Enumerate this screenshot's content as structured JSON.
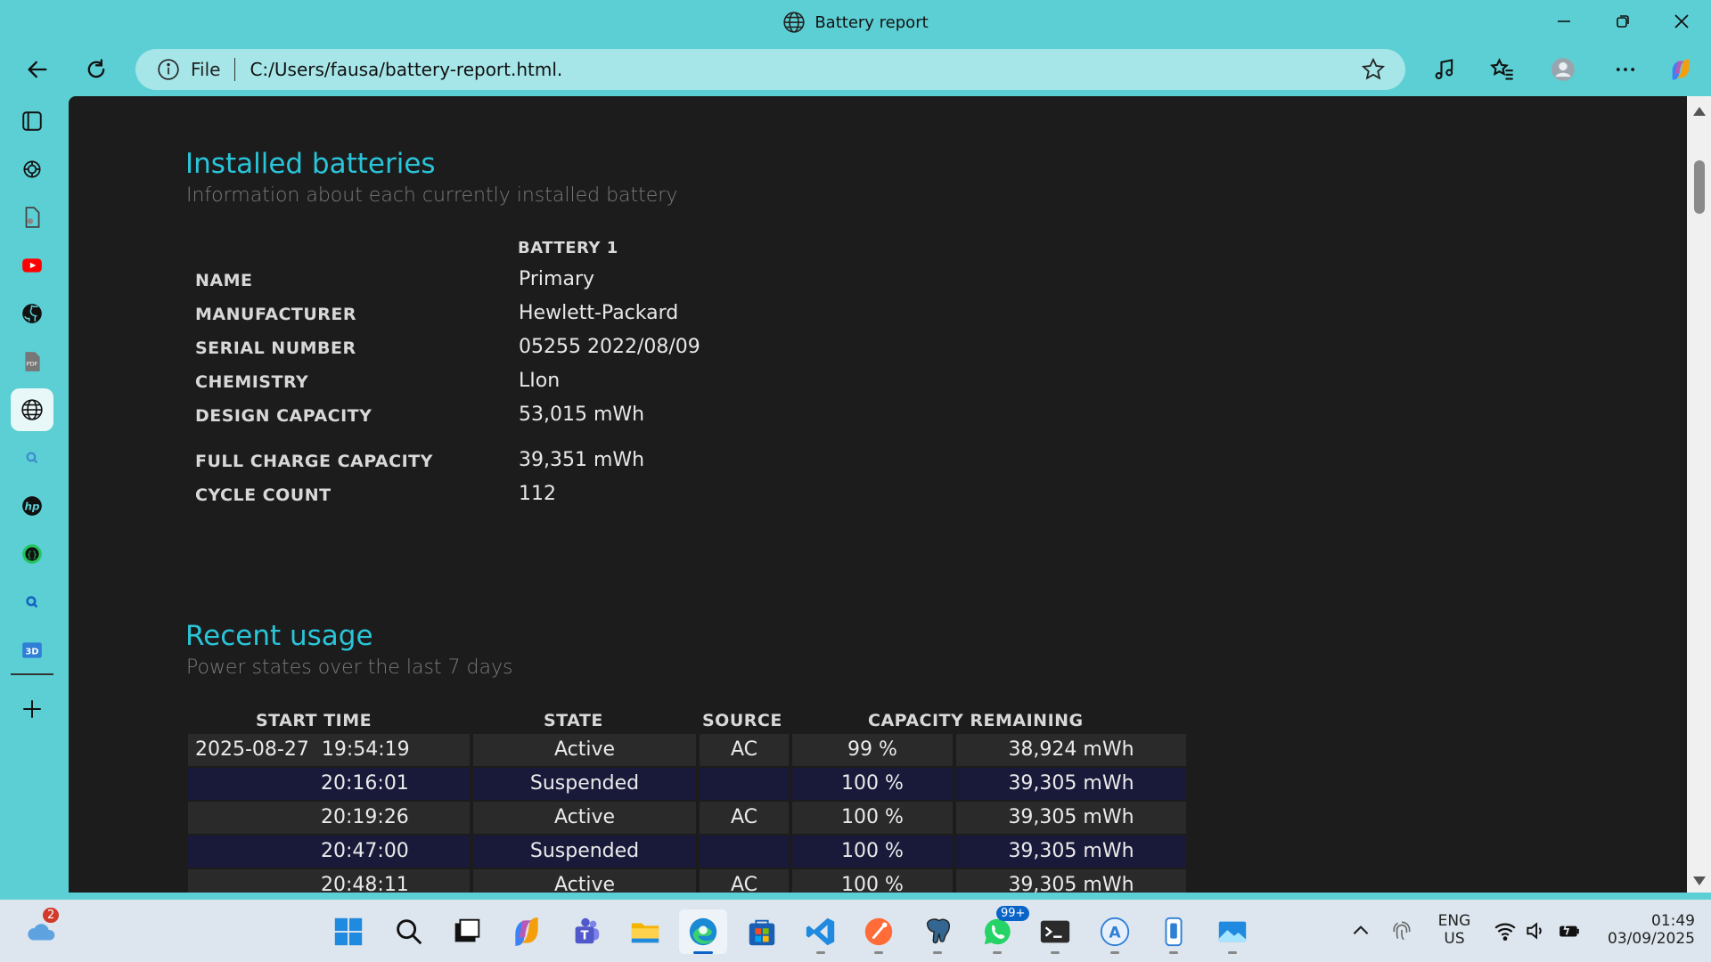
{
  "window": {
    "title": "Battery report"
  },
  "address_bar": {
    "scheme": "File",
    "url": "C:/Users/fausa/battery-report.html."
  },
  "sidebar": {
    "items": [
      "tab-actions",
      "chatgpt",
      "file",
      "youtube",
      "github",
      "pdf",
      "battery-report",
      "search",
      "hp",
      "code",
      "search-2",
      "3d"
    ],
    "3d_label": "3D"
  },
  "installed": {
    "title": "Installed batteries",
    "subtitle": "Information about each currently installed battery",
    "column": "BATTERY 1",
    "rows": [
      {
        "label": "NAME",
        "value": "Primary"
      },
      {
        "label": "MANUFACTURER",
        "value": "Hewlett-Packard"
      },
      {
        "label": "SERIAL NUMBER",
        "value": "05255 2022/08/09"
      },
      {
        "label": "CHEMISTRY",
        "value": "LIon"
      },
      {
        "label": "DESIGN CAPACITY",
        "value": "53,015 mWh"
      },
      {
        "label": "FULL CHARGE CAPACITY",
        "value": "39,351 mWh"
      },
      {
        "label": "CYCLE COUNT",
        "value": "112"
      }
    ]
  },
  "recent": {
    "title": "Recent usage",
    "subtitle": "Power states over the last 7 days",
    "headers": {
      "start_time": "START TIME",
      "state": "STATE",
      "source": "SOURCE",
      "capacity": "CAPACITY REMAINING"
    },
    "rows": [
      {
        "date": "2025-08-27",
        "time": "19:54:19",
        "state": "Active",
        "source": "AC",
        "pct": "99 %",
        "mwh": "38,924 mWh"
      },
      {
        "date": "",
        "time": "20:16:01",
        "state": "Suspended",
        "source": "",
        "pct": "100 %",
        "mwh": "39,305 mWh"
      },
      {
        "date": "",
        "time": "20:19:26",
        "state": "Active",
        "source": "AC",
        "pct": "100 %",
        "mwh": "39,305 mWh"
      },
      {
        "date": "",
        "time": "20:47:00",
        "state": "Suspended",
        "source": "",
        "pct": "100 %",
        "mwh": "39,305 mWh"
      },
      {
        "date": "",
        "time": "20:48:11",
        "state": "Active",
        "source": "AC",
        "pct": "100 %",
        "mwh": "39,305 mWh"
      }
    ]
  },
  "taskbar": {
    "weather_badge": "2",
    "whatsapp_badge": "99+",
    "lang": "ENG",
    "region": "US",
    "time": "01:49",
    "date": "03/09/2025"
  },
  "colors": {
    "accent": "#29c5d9",
    "frame": "#5ccfd4",
    "page_bg": "#1c1c1c",
    "row_even": "#2a2a2a",
    "row_odd": "#191a3a"
  }
}
